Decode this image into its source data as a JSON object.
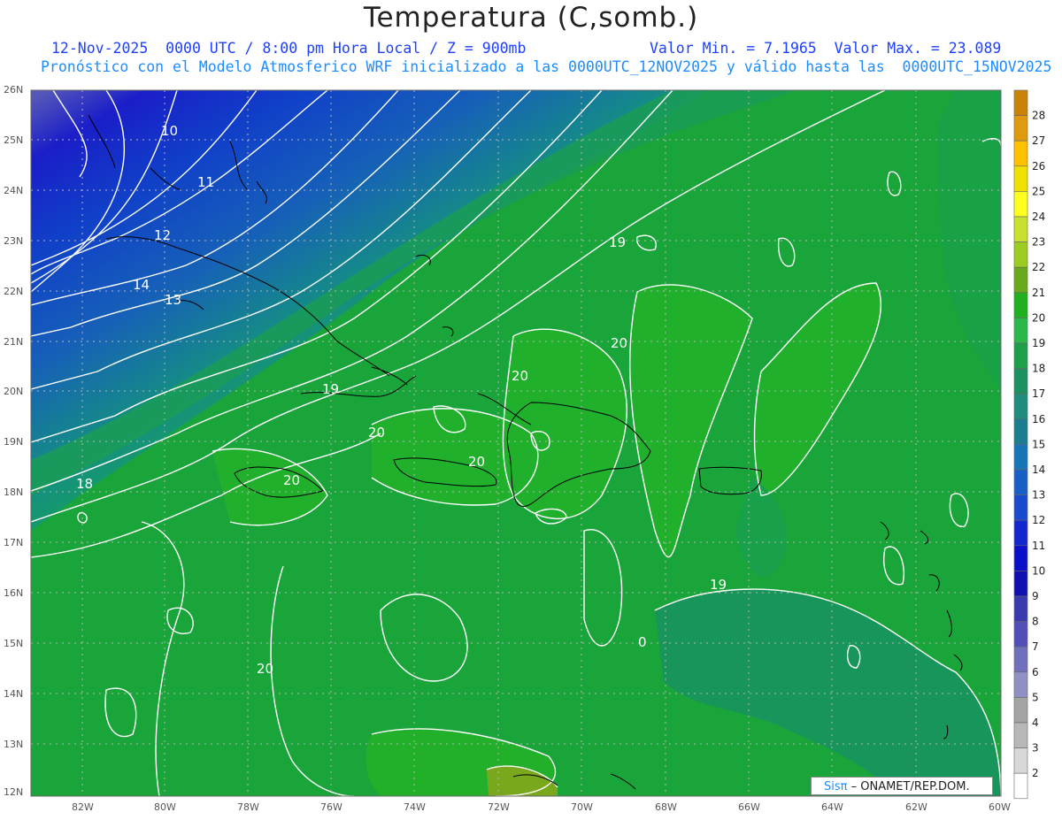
{
  "title": "Temperatura (C,somb.)",
  "subtitle": {
    "date_time": "12-Nov-2025  0000 UTC / 8:00 pm Hora Local / Z = 900mb",
    "value_range": "Valor Min. = 7.1965  Valor Max. = 23.089",
    "model_info": "Pronóstico con el Modelo Atmosferico WRF inicializado a las 0000UTC_12NOV2025 y válido hasta las  0000UTC_15NOV2025"
  },
  "credit": {
    "brand": "Sisπ",
    "org": " – ONAMET/REP.DOM."
  },
  "axes": {
    "lat_labels": [
      "26N",
      "25N",
      "24N",
      "23N",
      "22N",
      "21N",
      "20N",
      "19N",
      "18N",
      "17N",
      "16N",
      "15N",
      "14N",
      "13N",
      "12N"
    ],
    "lon_labels": [
      "82W",
      "80W",
      "78W",
      "76W",
      "74W",
      "72W",
      "70W",
      "68W",
      "66W",
      "64W",
      "62W",
      "60W"
    ]
  },
  "contour_labels": [
    "10",
    "11",
    "12",
    "14",
    "13",
    "19",
    "20",
    "20",
    "20",
    "20",
    "19",
    "18",
    "20",
    "20",
    "19",
    "0",
    "20"
  ],
  "colorbar": {
    "ticks": [
      "28",
      "27",
      "26",
      "25",
      "24",
      "23",
      "22",
      "21",
      "20",
      "19",
      "18",
      "17",
      "16",
      "15",
      "14",
      "13",
      "12",
      "11",
      "10",
      "9",
      "8",
      "7",
      "6",
      "5",
      "4",
      "3",
      "2"
    ],
    "colors": [
      "#c8820a",
      "#e09a10",
      "#ffc000",
      "#f0e000",
      "#ffff20",
      "#c8e030",
      "#9ccc22",
      "#6aa81c",
      "#20b020",
      "#2ab84a",
      "#1ea04a",
      "#1b9060",
      "#1f8c7e",
      "#1a7e90",
      "#1676b8",
      "#1860c8",
      "#1a4ad0",
      "#1428d0",
      "#0a10c8",
      "#1010b0",
      "#3a3ab0",
      "#5050b8",
      "#7070bc",
      "#9090c4",
      "#a4a4a4",
      "#b8b8b8",
      "#d8d8d8",
      "#ffffff"
    ]
  }
}
